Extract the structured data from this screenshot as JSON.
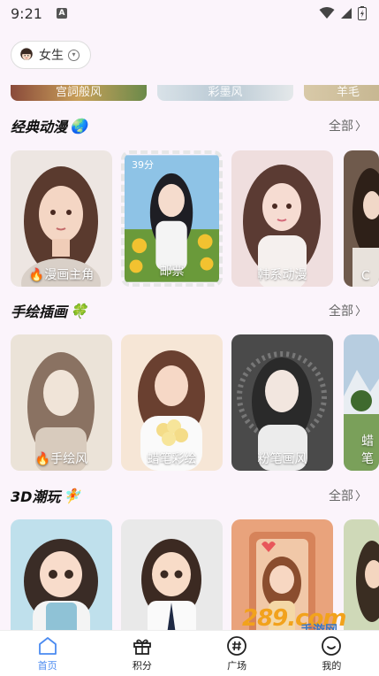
{
  "status_bar": {
    "time": "9:21",
    "notification_icon": "A"
  },
  "gender_selector": {
    "label": "女生",
    "icon": "girl-avatar-icon"
  },
  "top_strip": {
    "items": [
      "宫詞般风",
      "彩墨风",
      "羊毛"
    ]
  },
  "sections": [
    {
      "title": "经典动漫",
      "emoji": "🌏",
      "more_label": "全部",
      "cards": [
        {
          "label": "🔥漫画主角",
          "palette": [
            "#c79a85",
            "#5a3a2e"
          ]
        },
        {
          "label": "邮票",
          "palette": [
            "#7fb6df",
            "#f1c53b"
          ],
          "stamp_text": "39分"
        },
        {
          "label": "韩系动漫",
          "palette": [
            "#e8c8c8",
            "#5b3b33"
          ]
        },
        {
          "label": "C",
          "palette": [
            "#6f5a4c",
            "#3a2a22"
          ]
        }
      ]
    },
    {
      "title": "手绘插画",
      "emoji": "🍀",
      "more_label": "全部",
      "cards": [
        {
          "label": "🔥手绘风",
          "palette": [
            "#e9e0d4",
            "#7a6352"
          ]
        },
        {
          "label": "蜡笔彩绘",
          "palette": [
            "#f6e2d0",
            "#6a4030"
          ]
        },
        {
          "label": "粉笔画风",
          "palette": [
            "#4e4e4e",
            "#2b2b2b"
          ]
        },
        {
          "label": "蜡笔",
          "palette": [
            "#b7cde0",
            "#6b8c4b"
          ]
        }
      ]
    },
    {
      "title": "3D潮玩",
      "emoji": "🧚",
      "more_label": "全部",
      "cards": [
        {
          "label": "",
          "palette": [
            "#b8dbe8",
            "#4a3a34"
          ]
        },
        {
          "label": "",
          "palette": [
            "#e6e6e6",
            "#3c2a22"
          ]
        },
        {
          "label": "",
          "palette": [
            "#e7a07a",
            "#8a4d2e"
          ]
        },
        {
          "label": "",
          "palette": [
            "#c8d6b0",
            "#3a2d22"
          ]
        }
      ]
    }
  ],
  "watermark": {
    "big": "289.com",
    "small": "手游网"
  },
  "bottom_nav": [
    {
      "label": "首页",
      "icon": "home-icon",
      "active": true
    },
    {
      "label": "积分",
      "icon": "gift-icon",
      "active": false
    },
    {
      "label": "广场",
      "icon": "hashtag-icon",
      "active": false
    },
    {
      "label": "我的",
      "icon": "smile-face-icon",
      "active": false
    }
  ],
  "colors": {
    "accent": "#4a8af0",
    "background": "#fbf4fb"
  }
}
